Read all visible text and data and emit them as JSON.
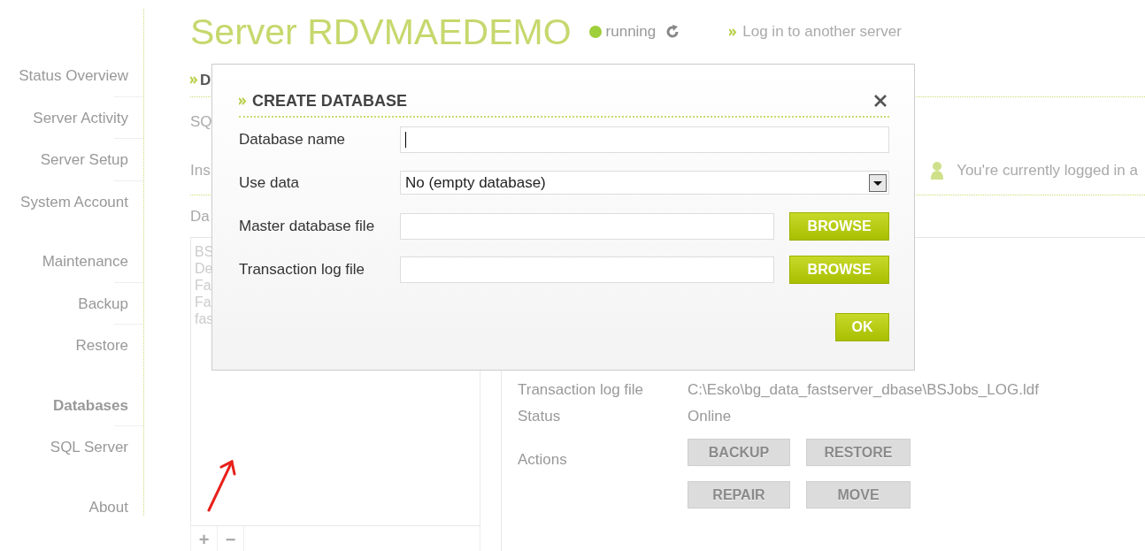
{
  "sidebar": {
    "groups": [
      {
        "items": [
          {
            "label": "Status Overview",
            "selected": false
          },
          {
            "label": "Server Activity",
            "selected": false
          },
          {
            "label": "Server Setup",
            "selected": false
          },
          {
            "label": "System Account",
            "selected": false
          }
        ]
      },
      {
        "items": [
          {
            "label": "Maintenance",
            "selected": false
          },
          {
            "label": "Backup",
            "selected": false
          },
          {
            "label": "Restore",
            "selected": false
          }
        ]
      },
      {
        "items": [
          {
            "label": "Databases",
            "selected": true
          },
          {
            "label": "SQL Server",
            "selected": false
          }
        ]
      },
      {
        "items": [
          {
            "label": "About",
            "selected": false
          }
        ]
      }
    ]
  },
  "header": {
    "title": "Server RDVMAEDEMO",
    "status": {
      "label": "running",
      "online": true
    },
    "login_link": "Log in to another server"
  },
  "tab": {
    "label": "D"
  },
  "background_labels": [
    "SQ",
    "Ins",
    "Da"
  ],
  "logged_in": "You're currently logged in a",
  "database_list": {
    "items": [
      "BS",
      "De",
      "Fa",
      "Fa",
      "fas"
    ],
    "buttons": [
      "+",
      "−"
    ]
  },
  "details": [
    {
      "label": "Transaction log file",
      "value": "C:\\Esko\\bg_data_fastserver_dbase\\BSJobs_LOG.ldf"
    },
    {
      "label": "Status",
      "value": "Online"
    }
  ],
  "actions": {
    "label": "Actions",
    "buttons": [
      {
        "label": "BACKUP",
        "disabled": true
      },
      {
        "label": "RESTORE",
        "disabled": true
      },
      {
        "label": "REPAIR",
        "disabled": true
      },
      {
        "label": "MOVE",
        "disabled": true
      }
    ]
  },
  "dialog": {
    "title": "CREATE DATABASE",
    "fields": [
      {
        "kind": "text",
        "label": "Database name",
        "focused": true
      },
      {
        "kind": "select",
        "label": "Use data",
        "value": "No (empty database)"
      },
      {
        "kind": "file",
        "label": "Master database file",
        "button": "BROWSE"
      },
      {
        "kind": "file",
        "label": "Transaction log file",
        "button": "BROWSE"
      }
    ],
    "ok": "OK"
  }
}
